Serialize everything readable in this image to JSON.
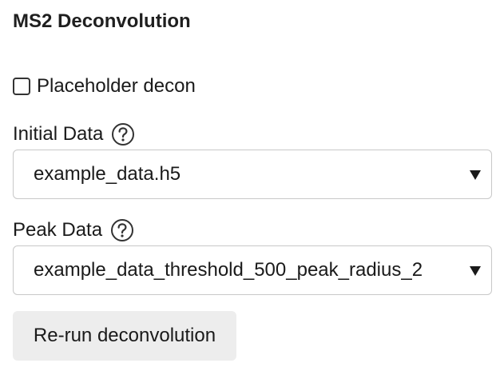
{
  "section": {
    "title": "MS2 Deconvolution"
  },
  "placeholder_decon": {
    "label": "Placeholder decon",
    "checked": false
  },
  "initial_data": {
    "label": "Initial Data",
    "help_icon": "question-circle-icon",
    "selected": "example_data.h5"
  },
  "peak_data": {
    "label": "Peak Data",
    "help_icon": "question-circle-icon",
    "selected": "example_data_threshold_500_peak_radius_2"
  },
  "rerun_button": {
    "label": "Re-run deconvolution"
  },
  "colors": {
    "button_background": "#ededed",
    "select_border": "#c8c8c8",
    "text": "#1a1a1a"
  }
}
